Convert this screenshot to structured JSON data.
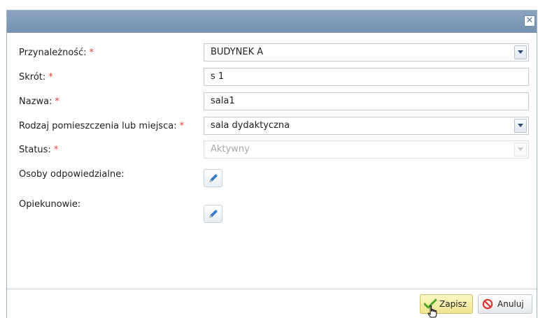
{
  "dialog": {
    "close_symbol": "✕"
  },
  "form": {
    "przynaleznosc": {
      "label": "Przynależność:",
      "required": "*",
      "value": "BUDYNEK A"
    },
    "skrot": {
      "label": "Skrót:",
      "required": "*",
      "value": "s 1"
    },
    "nazwa": {
      "label": "Nazwa:",
      "required": "*",
      "value": "sala1"
    },
    "rodzaj": {
      "label": "Rodzaj pomieszczenia lub miejsca:",
      "required": "*",
      "value": "sala dydaktyczna"
    },
    "status": {
      "label": "Status:",
      "required": "*",
      "value": "Aktywny"
    },
    "osoby": {
      "label": "Osoby odpowiedzialne:"
    },
    "opiekunowie": {
      "label": "Opiekunowie:"
    }
  },
  "footer": {
    "save_label": "Zapisz",
    "cancel_label": "Anuluj"
  },
  "icons": {
    "close": "close-icon",
    "dropdown": "chevron-down-icon",
    "edit": "pencil-icon",
    "save": "checkmark-icon",
    "cancel": "prohibited-icon",
    "cursor": "hand-cursor-icon"
  },
  "colors": {
    "titlebar": "#7e99b7",
    "required": "#e0403c",
    "save_button": "#efe58f"
  }
}
